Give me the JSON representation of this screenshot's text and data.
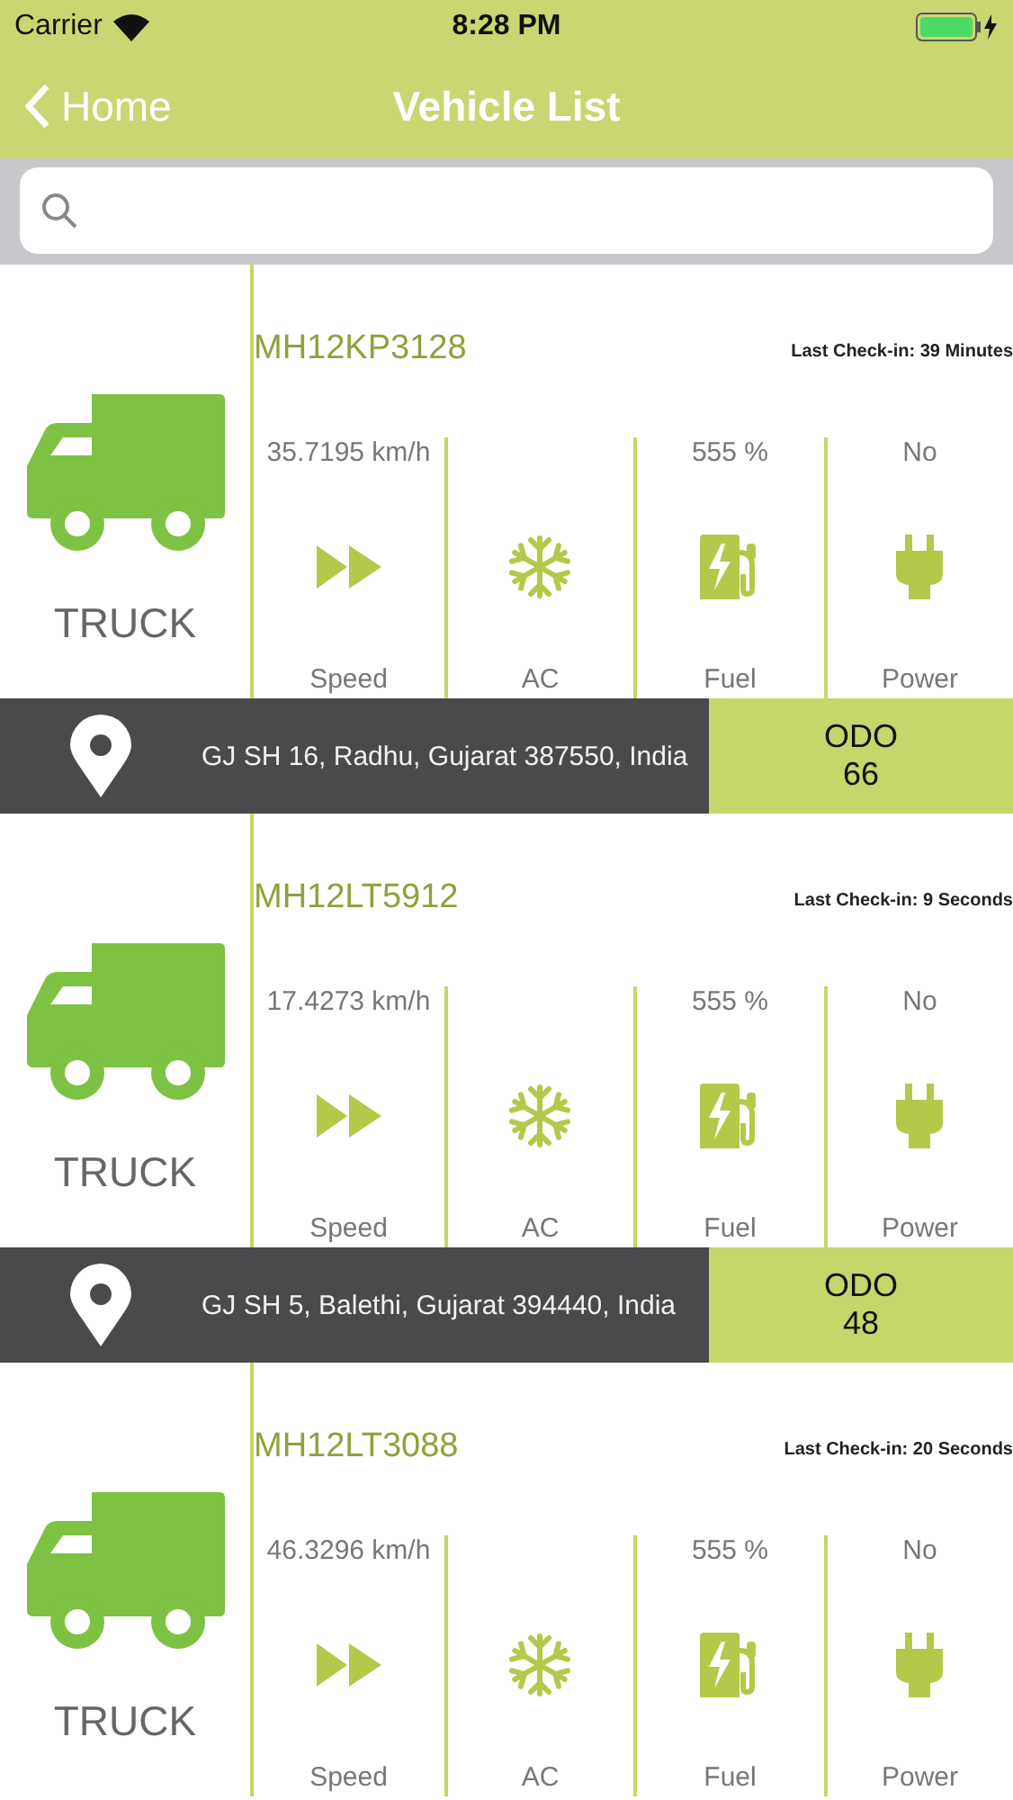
{
  "status_bar": {
    "carrier": "Carrier",
    "time": "8:28 PM"
  },
  "nav": {
    "back": "Home",
    "title": "Vehicle List"
  },
  "vehicles": [
    {
      "type": "TRUCK",
      "plate": "MH12KP3128",
      "last_checkin": "Last Check-in: 39 Minutes",
      "metrics": [
        {
          "kind": "speed",
          "value": "35.7195 km/h",
          "label": "Speed"
        },
        {
          "kind": "ac",
          "label": "AC"
        },
        {
          "kind": "fuel",
          "value": "555 %",
          "label": "Fuel"
        },
        {
          "kind": "power",
          "value": "No",
          "label": "Power"
        }
      ],
      "address": "GJ SH 16, Radhu, Gujarat 387550, India",
      "odo_label": "ODO",
      "odo": "66"
    },
    {
      "type": "TRUCK",
      "plate": "MH12LT5912",
      "last_checkin": "Last Check-in: 9 Seconds",
      "metrics": [
        {
          "kind": "speed",
          "value": "17.4273 km/h",
          "label": "Speed"
        },
        {
          "kind": "ac",
          "label": "AC"
        },
        {
          "kind": "fuel",
          "value": "555 %",
          "label": "Fuel"
        },
        {
          "kind": "power",
          "value": "No",
          "label": "Power"
        }
      ],
      "address": "GJ SH 5, Balethi, Gujarat 394440, India",
      "odo_label": "ODO",
      "odo": "48"
    },
    {
      "type": "TRUCK",
      "plate": "MH12LT3088",
      "last_checkin": "Last Check-in: 20 Seconds",
      "metrics": [
        {
          "kind": "speed",
          "value": "46.3296 km/h",
          "label": "Speed"
        },
        {
          "kind": "ac",
          "label": "AC"
        },
        {
          "kind": "fuel",
          "value": "555 %",
          "label": "Fuel"
        },
        {
          "kind": "power",
          "value": "No",
          "label": "Power"
        }
      ]
    }
  ]
}
